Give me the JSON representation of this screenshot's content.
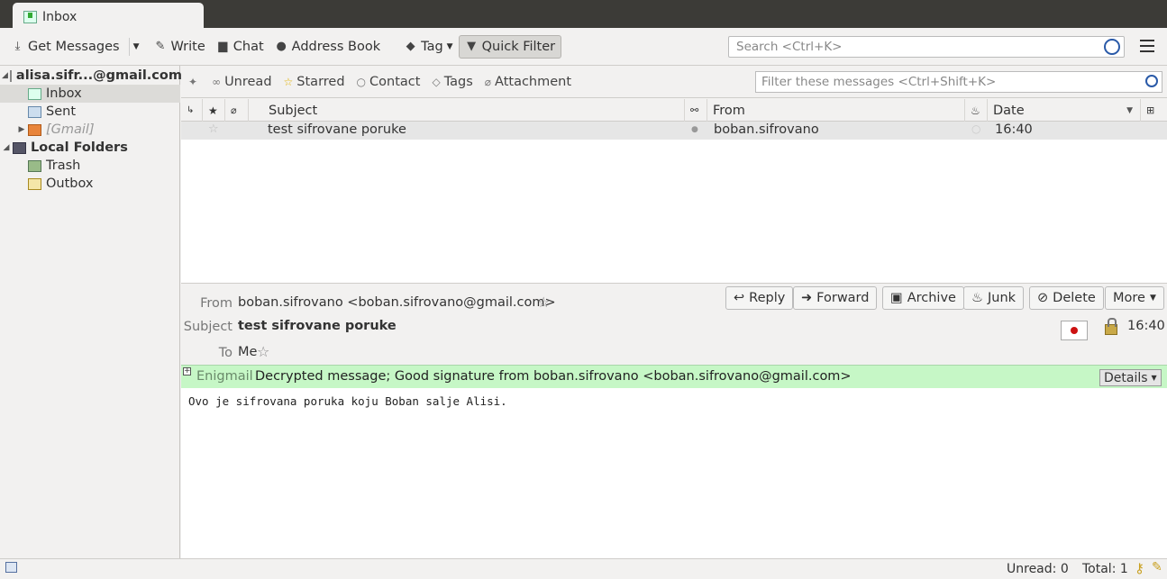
{
  "tab": {
    "title": "Inbox",
    "icon": "inbox-icon"
  },
  "toolbar": {
    "get_messages": "Get Messages",
    "write": "Write",
    "chat": "Chat",
    "address_book": "Address Book",
    "tag": "Tag",
    "quick_filter": "Quick Filter",
    "search_placeholder": "Search <Ctrl+K>"
  },
  "sidebar": {
    "account": "alisa.sifr...@gmail.com",
    "inbox": "Inbox",
    "sent": "Sent",
    "gmail": "[Gmail]",
    "local_folders": "Local Folders",
    "trash": "Trash",
    "outbox": "Outbox"
  },
  "quickfilter": {
    "unread": "Unread",
    "starred": "Starred",
    "contact": "Contact",
    "tags": "Tags",
    "attachment": "Attachment",
    "filter_placeholder": "Filter these messages <Ctrl+Shift+K>"
  },
  "columns": {
    "subject": "Subject",
    "from": "From",
    "date": "Date"
  },
  "messages": [
    {
      "subject": "test sifrovane poruke",
      "from": "boban.sifrovano",
      "date": "16:40"
    }
  ],
  "header": {
    "from_label": "From",
    "from_value": "boban.sifrovano <boban.sifrovano@gmail.com>",
    "subject_label": "Subject",
    "subject_value": "test sifrovane poruke",
    "to_label": "To",
    "to_value": "Me",
    "time": "16:40",
    "reply": "Reply",
    "forward": "Forward",
    "archive": "Archive",
    "junk": "Junk",
    "delete": "Delete",
    "more": "More"
  },
  "enigmail": {
    "label": "Enigmail",
    "status": "Decrypted message; Good signature from boban.sifrovano <boban.sifrovano@gmail.com>",
    "details": "Details",
    "color": "#c6f7c6"
  },
  "body_text": "Ovo je sifrovana poruka koju Boban salje Alisi.",
  "status": {
    "unread": "Unread: 0",
    "total": "Total: 1"
  }
}
